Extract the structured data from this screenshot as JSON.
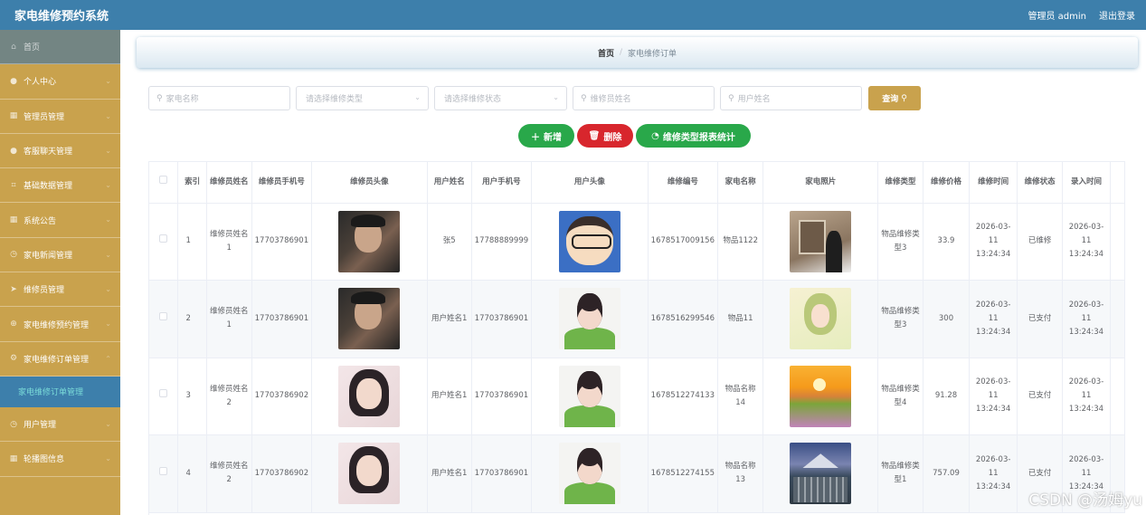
{
  "app": {
    "title": "家电维修预约系统",
    "admin_label": "管理员 admin",
    "logout_label": "退出登录"
  },
  "sidebar": {
    "items": [
      {
        "label": "首页",
        "icon": "home-icon"
      },
      {
        "label": "个人中心",
        "icon": "user-icon"
      },
      {
        "label": "管理员管理",
        "icon": "grid-icon"
      },
      {
        "label": "客服聊天管理",
        "icon": "user-icon"
      },
      {
        "label": "基础数据管理",
        "icon": "crop-icon"
      },
      {
        "label": "系统公告",
        "icon": "grid-icon"
      },
      {
        "label": "家电新闻管理",
        "icon": "clock-icon"
      },
      {
        "label": "维修员管理",
        "icon": "send-icon"
      },
      {
        "label": "家电维修预约管理",
        "icon": "plus-circle-icon"
      },
      {
        "label": "家电维修订单管理",
        "icon": "settings-icon"
      }
    ],
    "sub_item": "家电维修订单管理",
    "items_after": [
      {
        "label": "用户管理",
        "icon": "clock-icon"
      },
      {
        "label": "轮播图信息",
        "icon": "grid-icon"
      }
    ]
  },
  "breadcrumb": {
    "home": "首页",
    "sep": "/",
    "current": "家电维修订单"
  },
  "search": {
    "appliance_name": "家电名称",
    "repair_type": "请选择维修类型",
    "repair_status": "请选择维修状态",
    "repairman_name": "维修员姓名",
    "user_name": "用户姓名",
    "query_label": "查询"
  },
  "actions": {
    "add": "新增",
    "delete": "删除",
    "stats": "维修类型报表统计"
  },
  "table": {
    "headers": [
      "索引",
      "维修员姓名",
      "维修员手机号",
      "维修员头像",
      "用户姓名",
      "用户手机号",
      "用户头像",
      "维修编号",
      "家电名称",
      "家电照片",
      "维修类型",
      "维修价格",
      "维修时间",
      "维修状态",
      "录入时间"
    ],
    "rows": [
      {
        "index": "1",
        "repairman": "维修员姓名1",
        "repairman_phone": "17703786901",
        "repairman_avatar": "man",
        "user": "张5",
        "user_phone": "17788889999",
        "user_avatar": "conan",
        "order_no": "1678517009156",
        "appliance": "物品1122",
        "photo": "art",
        "type": "物品维修类型3",
        "price": "33.9",
        "repair_time": "2026-03-11 13:24:34",
        "status": "已维修",
        "created": "2026-03-11 13:24:34"
      },
      {
        "index": "2",
        "repairman": "维修员姓名1",
        "repairman_phone": "17703786901",
        "repairman_avatar": "man",
        "user": "用户姓名1",
        "user_phone": "17703786901",
        "user_avatar": "green",
        "order_no": "1678516299546",
        "appliance": "物品11",
        "photo": "fairy",
        "type": "物品维修类型3",
        "price": "300",
        "repair_time": "2026-03-11 13:24:34",
        "status": "已支付",
        "created": "2026-03-11 13:24:34"
      },
      {
        "index": "3",
        "repairman": "维修员姓名2",
        "repairman_phone": "17703786902",
        "repairman_avatar": "girl",
        "user": "用户姓名1",
        "user_phone": "17703786901",
        "user_avatar": "green",
        "order_no": "1678512274133",
        "appliance": "物品名称14",
        "photo": "sunset",
        "type": "物品维修类型4",
        "price": "91.28",
        "repair_time": "2026-03-11 13:24:34",
        "status": "已支付",
        "created": "2026-03-11 13:24:34"
      },
      {
        "index": "4",
        "repairman": "维修员姓名2",
        "repairman_phone": "17703786902",
        "repairman_avatar": "girl",
        "user": "用户姓名1",
        "user_phone": "17703786901",
        "user_avatar": "green",
        "order_no": "1678512274155",
        "appliance": "物品名称13",
        "photo": "city",
        "type": "物品维修类型1",
        "price": "757.09",
        "repair_time": "2026-03-11 13:24:34",
        "status": "已支付",
        "created": "2026-03-11 13:24:34"
      }
    ]
  },
  "watermark": "CSDN @汤姆yu",
  "colors": {
    "topbar": "#3d7fab",
    "sidebar": "#c9a24d",
    "accent_green": "#29a84a",
    "danger": "#d8262d"
  }
}
